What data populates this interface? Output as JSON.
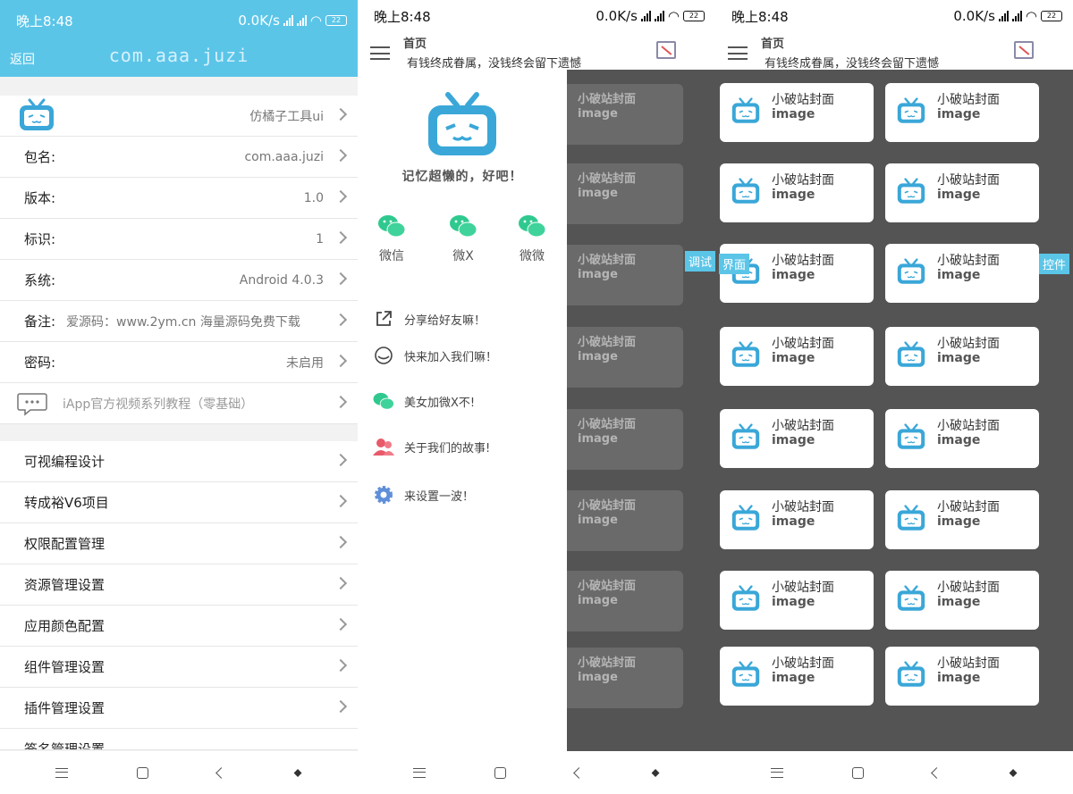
{
  "status": {
    "time": "晚上8:48",
    "speed": "0.0K/s",
    "battery": "22"
  },
  "panel1": {
    "back_label": "返回",
    "title": "com.aaa.juzi",
    "app_name": "仿橘子工具ui",
    "info_rows": [
      {
        "label": "包名:",
        "value": "com.aaa.juzi"
      },
      {
        "label": "版本:",
        "value": "1.0"
      },
      {
        "label": "标识:",
        "value": "1"
      },
      {
        "label": "系统:",
        "value": "Android 4.0.3"
      },
      {
        "label": "备注:",
        "value": "爱源码：www.2ym.cn 海量源码免费下载"
      },
      {
        "label": "密码:",
        "value": "未启用"
      }
    ],
    "tutorial": "iApp官方视频系列教程（零基础）",
    "settings": [
      "可视编程设计",
      "转成裕V6项目",
      "权限配置管理",
      "资源管理设置",
      "应用颜色配置",
      "组件管理设置",
      "插件管理设置",
      "签名管理设置"
    ]
  },
  "panel2": {
    "header_title": "首页",
    "header_subtitle": "有钱终成眷属，没钱终会留下遗憾",
    "slogan": "记忆超懒的，好吧！",
    "social": [
      "微信",
      "微X",
      "微微"
    ],
    "menu": [
      "分享给好友嘛！",
      "快来加入我们嘛！",
      "美女加微X不!",
      "关于我们的故事!",
      "来设置一波！"
    ],
    "floating_debug": "调试"
  },
  "panel3": {
    "header_title": "首页",
    "header_subtitle": "有钱终成眷属，没钱终会留下遗憾",
    "tile_title": "小破站封面",
    "tile_subtitle": "image",
    "floating_left": "界面",
    "floating_right": "控件"
  },
  "colors": {
    "accent": "#5bc5e8",
    "scrim": "#545454",
    "wechat": "#2fc98f"
  }
}
